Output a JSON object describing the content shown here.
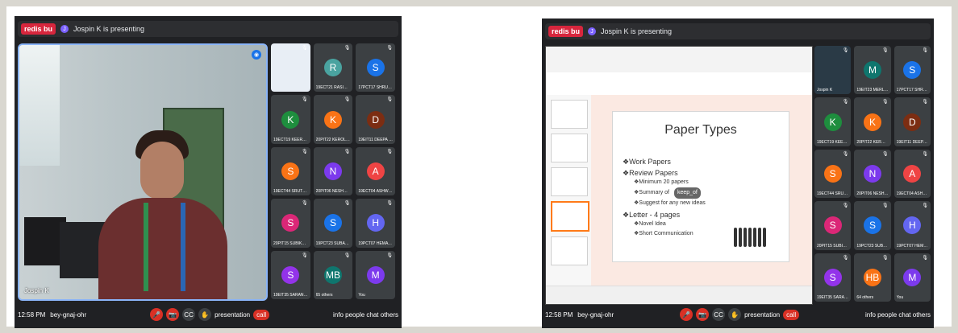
{
  "left_window": {
    "header": {
      "logo_text": "redis bu",
      "presenting_avatar_initial": "J",
      "presenting_text": "Jospin K is presenting"
    },
    "main_speaker": {
      "name_tag": "Jospin K"
    },
    "participants": [
      {
        "kind": "screen",
        "name": "",
        "initial": "",
        "color": "#e8eef5"
      },
      {
        "kind": "avatar",
        "name": "19ECT21 RASIGA D",
        "initial": "R",
        "color": "#4aa3a0"
      },
      {
        "kind": "avatar",
        "name": "17PCT17 SHRUTHI S",
        "initial": "S",
        "color": "#1a73e8"
      },
      {
        "kind": "avatar",
        "name": "19ECT19 KEERTHANA R",
        "initial": "K",
        "color": "#1e8e3e"
      },
      {
        "kind": "avatar",
        "name": "20PIT22 KEROLIN PR...",
        "initial": "K",
        "color": "#f97316"
      },
      {
        "kind": "avatar",
        "name": "19EIT11 DEEPA DHAR...",
        "initial": "D",
        "color": "#7c2d12"
      },
      {
        "kind": "avatar",
        "name": "19ECT44 SRUTHI P",
        "initial": "S",
        "color": "#f97316"
      },
      {
        "kind": "avatar",
        "name": "20PIT06 NESHMITHA...",
        "initial": "N",
        "color": "#7c3aed"
      },
      {
        "kind": "avatar",
        "name": "19ECT04 ASHWINI R",
        "initial": "A",
        "color": "#ef4444"
      },
      {
        "kind": "avatar",
        "name": "20PIT15 SUBIKSHA M",
        "initial": "S",
        "color": "#db2777"
      },
      {
        "kind": "avatar",
        "name": "19PCT23 SUBADARSH...",
        "initial": "S",
        "color": "#1a73e8"
      },
      {
        "kind": "avatar",
        "name": "19PCT07 HEMA SHRE...",
        "initial": "H",
        "color": "#6366f1"
      },
      {
        "kind": "avatar",
        "name": "19EIT35 SARANYA T",
        "initial": "S",
        "color": "#9333ea"
      },
      {
        "kind": "avatar",
        "name": "65 others",
        "initial": "MB",
        "color": "#0f766e"
      },
      {
        "kind": "avatar",
        "name": "You",
        "initial": "M",
        "color": "#7c3aed"
      }
    ],
    "bottom": {
      "time": "12:58 PM",
      "meeting_code": "bey-gnaj-ohr",
      "controls": [
        "mic",
        "cam",
        "cc",
        "hand"
      ],
      "present_label": "presentation",
      "call_label": "call",
      "info_label": "info people chat others"
    }
  },
  "right_window": {
    "header": {
      "logo_text": "redis bu",
      "presenting_avatar_initial": "J",
      "presenting_text": "Jospin K is presenting"
    },
    "slide": {
      "title": "Paper Types",
      "bullets": [
        {
          "level": 1,
          "text": "❖Work Papers"
        },
        {
          "level": 1,
          "text": "❖Review Papers"
        },
        {
          "level": 2,
          "text": "❖Minimum 20 papers"
        },
        {
          "level": 2,
          "text": "❖Summary of ",
          "bubble": "keep_of"
        },
        {
          "level": 2,
          "text": "❖Suggest for any new ideas"
        },
        {
          "level": 1,
          "text": "❖Letter - 4 pages"
        },
        {
          "level": 2,
          "text": "❖Novel Idea"
        },
        {
          "level": 2,
          "text": "❖Short Communication"
        }
      ]
    },
    "participants": [
      {
        "kind": "cam",
        "name": "Jospin K",
        "initial": "",
        "color": "#2a3a46"
      },
      {
        "kind": "avatar",
        "name": "19EIT23 MERLIN YUDI...",
        "initial": "M",
        "color": "#0f766e"
      },
      {
        "kind": "avatar",
        "name": "17PCT17 SHRUTHI S",
        "initial": "S",
        "color": "#1a73e8"
      },
      {
        "kind": "avatar",
        "name": "19ECT19 KEERTHANA R",
        "initial": "K",
        "color": "#1e8e3e"
      },
      {
        "kind": "avatar",
        "name": "20PIT22 KEROLIN PR...",
        "initial": "K",
        "color": "#f97316"
      },
      {
        "kind": "avatar",
        "name": "19EIT11 DEEPA DHAR...",
        "initial": "D",
        "color": "#7c2d12"
      },
      {
        "kind": "avatar",
        "name": "19ECT44 SRUTHI P",
        "initial": "S",
        "color": "#f97316"
      },
      {
        "kind": "avatar",
        "name": "20PIT06 NESHMITHA...",
        "initial": "N",
        "color": "#7c3aed"
      },
      {
        "kind": "avatar",
        "name": "19ECT04 ASHWINI R",
        "initial": "A",
        "color": "#ef4444"
      },
      {
        "kind": "avatar",
        "name": "20PIT15 SUBIKSHA M",
        "initial": "S",
        "color": "#db2777"
      },
      {
        "kind": "avatar",
        "name": "19PCT23 SUBADARSH...",
        "initial": "S",
        "color": "#1a73e8"
      },
      {
        "kind": "avatar",
        "name": "19PCT07 HEMA SHRE...",
        "initial": "H",
        "color": "#6366f1"
      },
      {
        "kind": "avatar",
        "name": "19EIT35 SARANYA T",
        "initial": "S",
        "color": "#9333ea"
      },
      {
        "kind": "avatar",
        "name": "64 others",
        "initial": "HB",
        "color": "#f97316"
      },
      {
        "kind": "avatar",
        "name": "You",
        "initial": "M",
        "color": "#7c3aed"
      }
    ],
    "bottom": {
      "time": "12:58 PM",
      "meeting_code": "bey-gnaj-ohr",
      "present_label": "presentation",
      "call_label": "call",
      "info_label": "info people chat others"
    }
  }
}
